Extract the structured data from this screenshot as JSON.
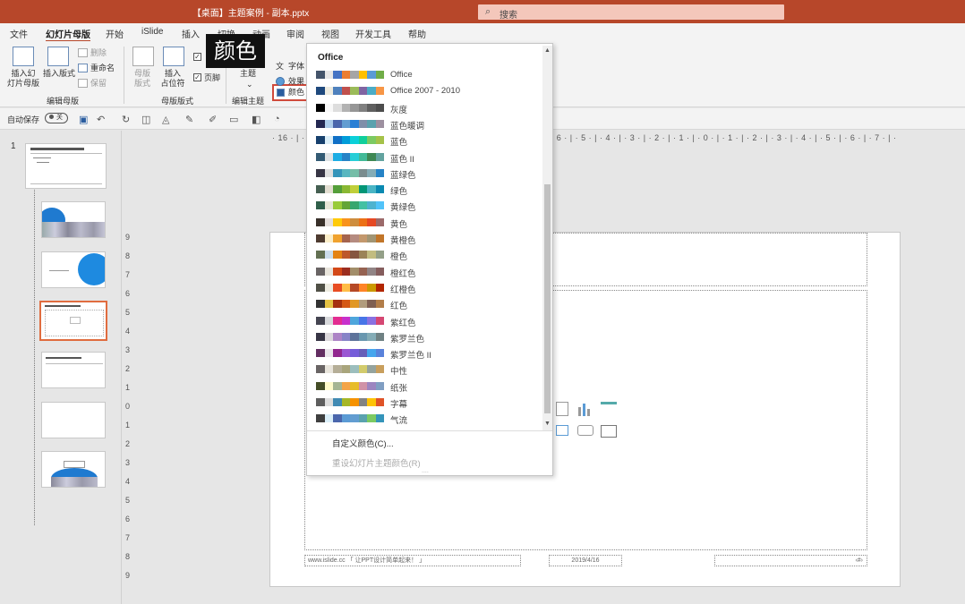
{
  "window": {
    "title": "【桌面】主题案例 - 副本.pptx",
    "search_placeholder": "搜索"
  },
  "menu": [
    "文件",
    "幻灯片母版",
    "开始",
    "iSlide",
    "插入",
    "切换",
    "动画",
    "审阅",
    "视图",
    "开发工具",
    "帮助"
  ],
  "ribbon": {
    "insert_master": "插入幻\n灯片母版",
    "insert_layout": "插入版式",
    "delete": "删除",
    "rename": "重命名",
    "preserve": "保留",
    "group_edit_master": "编辑母版",
    "master_layout": "母版\n版式",
    "insert_placeholder": "插入\n占位符",
    "footer": "页脚",
    "group_master_layout": "母版版式",
    "themes": "主题",
    "group_edit_theme": "编辑主题",
    "colors": "颜色",
    "fonts": "字体",
    "effects": "效果"
  },
  "callout": "颜色",
  "qat": {
    "autosave": "自动保存",
    "toggle": "关"
  },
  "rulers": {
    "horizontal": "· 16 · | · 15 · | · 14 · | · 13 · | · 12 · | · 11 · | · 10 · | · 9 · | · 8 · | · 7 · | · 6 · | · 5 · | · 4 · | · 3 · | · 2 · | · 1 · | · 0 · | · 1 · | · 2 · | · 3 · | · 4 · | · 5 · | · 6 · | · 7 · | · 8 · | · 9 · | · 10 · | · 11 · | · 12 · | · 13 · | · 14 · | · 15 · | · 16 ·",
    "vertical": [
      "9",
      "8",
      "7",
      "6",
      "5",
      "4",
      "3",
      "2",
      "1",
      "0",
      "1",
      "2",
      "3",
      "4",
      "5",
      "6",
      "7",
      "8",
      "9"
    ]
  },
  "thumbnails": {
    "first_number": "1"
  },
  "slide": {
    "footer_left": "www.islide.cc 「 让PPT设计简单起来！ 」",
    "footer_date": "2019/4/16",
    "footer_num": "‹#›"
  },
  "dropdown": {
    "header": "Office",
    "schemes": [
      {
        "name": "Office",
        "colors": [
          "#44546a",
          "#e7e6e6",
          "#4472c4",
          "#ed7d31",
          "#a5a5a5",
          "#ffc000",
          "#5b9bd5",
          "#70ad47"
        ]
      },
      {
        "name": "Office 2007 - 2010",
        "colors": [
          "#1f497d",
          "#eeece1",
          "#4f81bd",
          "#c0504d",
          "#9bbb59",
          "#8064a2",
          "#4bacc6",
          "#f79646"
        ]
      },
      {
        "name": "灰度",
        "colors": [
          "#000000",
          "#f8f8f8",
          "#dddddd",
          "#b2b2b2",
          "#969696",
          "#808080",
          "#5f5f5f",
          "#4d4d4d"
        ]
      },
      {
        "name": "蓝色暖调",
        "colors": [
          "#242852",
          "#acccea",
          "#4a66ac",
          "#629dd1",
          "#297fd5",
          "#7f8fa9",
          "#5aa2ae",
          "#9d90a0"
        ]
      },
      {
        "name": "蓝色",
        "colors": [
          "#17406d",
          "#dbeff9",
          "#0f6fc6",
          "#009dd9",
          "#0bd0d9",
          "#10cf9b",
          "#7cca62",
          "#a5c249"
        ]
      },
      {
        "name": "蓝色 II",
        "colors": [
          "#335b74",
          "#dfe3e5",
          "#1cade4",
          "#2683c6",
          "#27ced7",
          "#42ba97",
          "#3e8853",
          "#62a39f"
        ]
      },
      {
        "name": "蓝绿色",
        "colors": [
          "#373545",
          "#dedede",
          "#3494ba",
          "#58b6c0",
          "#75bda7",
          "#7a8c8e",
          "#84acb6",
          "#2683c6"
        ]
      },
      {
        "name": "绿色",
        "colors": [
          "#455f51",
          "#e3ded1",
          "#549e39",
          "#8ab833",
          "#c0cf3a",
          "#029676",
          "#4ab5c4",
          "#0989b1"
        ]
      },
      {
        "name": "黄绿色",
        "colors": [
          "#2f5f4a",
          "#e6e6d6",
          "#99cb38",
          "#63a537",
          "#37a76f",
          "#44c1a3",
          "#4eb3cf",
          "#51c3f9"
        ]
      },
      {
        "name": "黄色",
        "colors": [
          "#39302a",
          "#e5dedb",
          "#ffca08",
          "#f8931d",
          "#ce8d3e",
          "#ec7016",
          "#e64823",
          "#9c6a6a"
        ]
      },
      {
        "name": "黄橙色",
        "colors": [
          "#4e3b30",
          "#fbeec9",
          "#f0a22e",
          "#a5644e",
          "#b58b80",
          "#c3986d",
          "#a19574",
          "#c17529"
        ]
      },
      {
        "name": "橙色",
        "colors": [
          "#637052",
          "#ccddea",
          "#e48312",
          "#bd582c",
          "#865640",
          "#9b8357",
          "#c2bc80",
          "#94a088"
        ]
      },
      {
        "name": "橙红色",
        "colors": [
          "#696464",
          "#e9e5dc",
          "#d34817",
          "#9b2d1f",
          "#a28e6a",
          "#956251",
          "#918485",
          "#855d5d"
        ]
      },
      {
        "name": "红橙色",
        "colors": [
          "#505046",
          "#eeece1",
          "#e84c22",
          "#ffbd47",
          "#b64926",
          "#ff8427",
          "#cc9900",
          "#b22600"
        ]
      },
      {
        "name": "红色",
        "colors": [
          "#323232",
          "#e5c243",
          "#a5300f",
          "#d55816",
          "#e19825",
          "#b19c7d",
          "#7f5f52",
          "#b27d49"
        ]
      },
      {
        "name": "紫红色",
        "colors": [
          "#454551",
          "#d8d9dc",
          "#e32d91",
          "#c830cc",
          "#4ea6dc",
          "#4775e7",
          "#8971e1",
          "#d54773"
        ]
      },
      {
        "name": "紫罗兰色",
        "colors": [
          "#373545",
          "#dcd8dc",
          "#ad84c6",
          "#8784c7",
          "#5d739a",
          "#6997af",
          "#84acb6",
          "#6f8183"
        ]
      },
      {
        "name": "紫罗兰色 II",
        "colors": [
          "#632e62",
          "#eae5eb",
          "#92278f",
          "#9b57d3",
          "#755dd9",
          "#665eb8",
          "#45a5ed",
          "#5982db"
        ]
      },
      {
        "name": "中性",
        "colors": [
          "#696464",
          "#e9e5dc",
          "#b5ae97",
          "#a9a57c",
          "#9cbebd",
          "#d2cb6c",
          "#95a39d",
          "#c89f5d"
        ]
      },
      {
        "name": "纸张",
        "colors": [
          "#444d26",
          "#fefac9",
          "#a5b592",
          "#f3a447",
          "#e7bc29",
          "#d092a7",
          "#9c85c0",
          "#809ec2"
        ]
      },
      {
        "name": "字幕",
        "colors": [
          "#5e5e5e",
          "#dddddd",
          "#418ab3",
          "#a6b727",
          "#f69200",
          "#838383",
          "#fec306",
          "#df5327"
        ]
      },
      {
        "name": "气流",
        "colors": [
          "#3f3f3f",
          "#dbeff9",
          "#4a66ac",
          "#5b9bd5",
          "#629dd1",
          "#5aa2ae",
          "#7cca62",
          "#3494ba"
        ]
      }
    ],
    "custom_colors": "自定义颜色(C)...",
    "reset_colors": "重设幻灯片主题颜色(R)"
  }
}
